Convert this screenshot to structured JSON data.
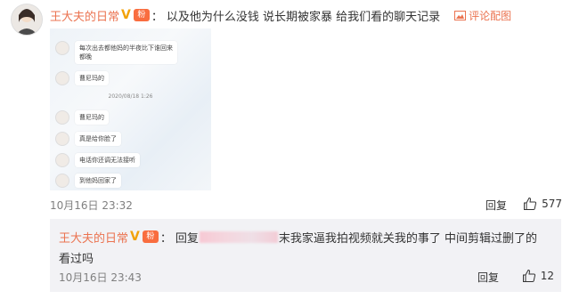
{
  "comment": {
    "username": "王大夫的日常",
    "separator": "：",
    "text": "以及他为什么没钱 说长期被家暴 给我们看的聊天记录",
    "reply_with_pic_label": "评论配图",
    "time": "10月16日 23:32",
    "reply_label": "回复",
    "like_count": "577",
    "image": {
      "messages": [
        "每次出去都他妈的半夜比下谁回来\n都晚",
        "曹尼玛的",
        "曹尼玛的",
        "真是给你脸了",
        "电话你还调无法接听",
        "到他妈回家了"
      ],
      "timestamp": "2020/08/18 1:26"
    }
  },
  "sub_comment": {
    "username": "王大夫的日常",
    "separator": "：",
    "reply_prefix": "回复",
    "text_line1": "末我家逼我拍视频就关我的事了 中间剪辑过删了的",
    "text_line2": "看过吗",
    "time": "10月16日 23:43",
    "reply_label": "回复",
    "like_count": "12"
  },
  "colors": {
    "username": "#eb7350",
    "badge_v": "#f2a20a",
    "sub_bg": "#f2f2f5"
  }
}
